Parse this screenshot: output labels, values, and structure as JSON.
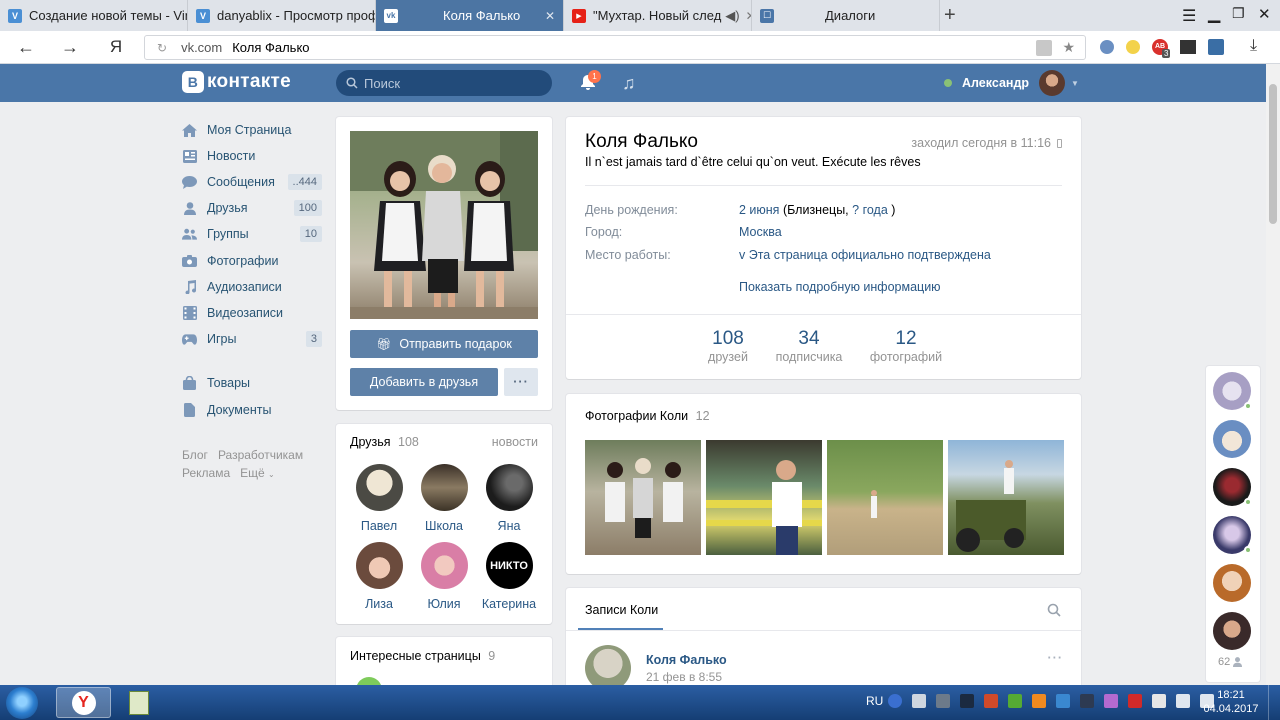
{
  "browser": {
    "tabs": [
      {
        "title": "Создание новой темы - Vin",
        "favicon_color": "#4a8fd4",
        "favicon": "V"
      },
      {
        "title": "danyablix - Просмотр проф",
        "favicon_color": "#4a8fd4",
        "favicon": "V"
      },
      {
        "title": "Коля Фалько",
        "favicon_color": "#ffffff",
        "favicon": "vk",
        "active": true
      },
      {
        "title": "\"Мухтар. Новый след",
        "favicon_color": "#e62117",
        "favicon": "▶"
      },
      {
        "title": "Диалоги",
        "favicon_color": "#4a76a8",
        "favicon": "☐"
      }
    ],
    "new_tab": "+",
    "nav": {
      "back": "←",
      "forward": "→",
      "yandex": "Я",
      "reload": "C"
    },
    "url_domain": "vk.com",
    "url_title": "Коля Фалько",
    "extension_badge": "3"
  },
  "header": {
    "logo_text": "контакте",
    "logo_letter": "В",
    "search_placeholder": "Поиск",
    "notif_count": "1",
    "user_name": "Александр",
    "accent": "#4a76a8"
  },
  "menu": {
    "items": [
      {
        "label": "Моя Страница",
        "icon": "home-icon",
        "count": ""
      },
      {
        "label": "Новости",
        "icon": "news-icon",
        "count": ""
      },
      {
        "label": "Сообщения",
        "icon": "message-icon",
        "count": "..444"
      },
      {
        "label": "Друзья",
        "icon": "user-icon",
        "count": "100"
      },
      {
        "label": "Группы",
        "icon": "group-icon",
        "count": "10"
      },
      {
        "label": "Фотографии",
        "icon": "camera-icon",
        "count": ""
      },
      {
        "label": "Аудиозаписи",
        "icon": "music-icon",
        "count": ""
      },
      {
        "label": "Видеозаписи",
        "icon": "film-icon",
        "count": ""
      },
      {
        "label": "Игры",
        "icon": "gamepad-icon",
        "count": "3"
      },
      {
        "label": "Товары",
        "icon": "bag-icon",
        "count": ""
      },
      {
        "label": "Документы",
        "icon": "doc-icon",
        "count": ""
      }
    ],
    "footer": {
      "blog": "Блог",
      "developers": "Разработчикам",
      "ads": "Реклама",
      "more": "Ещё"
    }
  },
  "profile": {
    "name": "Коля Фалько",
    "last_seen": "заходил сегодня в 11:16",
    "status": "Il n`est jamais tard d`être celui qu`on veut. Exécute les rêves",
    "send_gift": "Отправить подарок",
    "add_friend": "Добавить в друзья",
    "more": "···",
    "info": {
      "birthday_label": "День рождения:",
      "birthday_value": "2 июня",
      "birthday_sign": "(Близнецы,",
      "birthday_year": "? года",
      "birthday_close": ")",
      "city_label": "Город:",
      "city_value": "Москва",
      "work_label": "Место работы:",
      "work_value": "v Эта страница официально подтверждена",
      "show_more": "Показать подробную информацию"
    },
    "counters": [
      {
        "num": "108",
        "label": "друзей"
      },
      {
        "num": "34",
        "label": "подписчика"
      },
      {
        "num": "12",
        "label": "фотографий"
      }
    ]
  },
  "friends": {
    "title": "Друзья",
    "count": "108",
    "news": "новости",
    "list": [
      "Павел",
      "Школа",
      "Яна",
      "Лиза",
      "Юлия",
      "Катерина"
    ],
    "katerina_avatar_text": "НИКТО"
  },
  "interesting": {
    "title": "Интересные страницы",
    "count": "9"
  },
  "photos": {
    "title": "Фотографии Коли",
    "count": "12"
  },
  "wall": {
    "tab": "Записи Коли",
    "post_author": "Коля Фалько",
    "post_date": "21 фев в 8:55",
    "more": "···"
  },
  "chatbar": {
    "online_count": "62"
  },
  "taskbar": {
    "lang": "RU",
    "time": "18:21",
    "date": "04.04.2017"
  }
}
